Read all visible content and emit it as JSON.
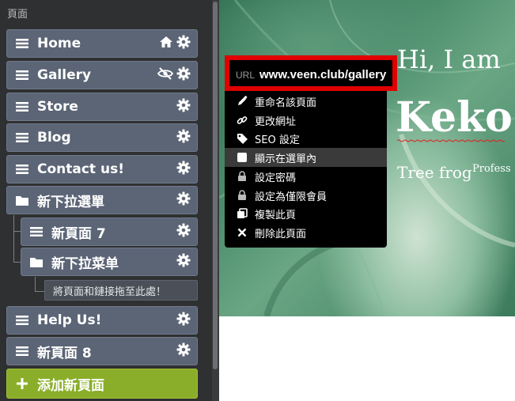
{
  "sidebar": {
    "title": "頁面",
    "pages": [
      {
        "label": "Home",
        "home": true
      },
      {
        "label": "Gallery",
        "hidden": true
      },
      {
        "label": "Store"
      },
      {
        "label": "Blog"
      },
      {
        "label": "Contact us!"
      },
      {
        "label": "新下拉選單"
      },
      {
        "label": "新頁面 7"
      },
      {
        "label": "新下拉菜单"
      },
      {
        "label": "Help Us!"
      },
      {
        "label": "新頁面 8"
      }
    ],
    "drop_hint": "將頁面和鏈接拖至此處！",
    "add_button": "添加新頁面"
  },
  "preview": {
    "greeting": "Hi, I am",
    "name": "Keko",
    "subtitle": "Tree frog",
    "subtitle_sup": "Profess"
  },
  "context_menu": {
    "url_prefix": "URL",
    "url": "www.veen.club/gallery",
    "items": [
      {
        "label": "重命名該頁面",
        "icon": "pencil-icon"
      },
      {
        "label": "更改網址",
        "icon": "link-icon"
      },
      {
        "label": "SEO 設定",
        "icon": "tag-icon"
      },
      {
        "label": "顯示在選單內",
        "icon": "checkbox-icon"
      },
      {
        "label": "設定密碼",
        "icon": "lock-icon"
      },
      {
        "label": "設定為僅限會員",
        "icon": "lock-icon"
      },
      {
        "label": "複製此頁",
        "icon": "copy-icon"
      },
      {
        "label": "刪除此頁面",
        "icon": "close-icon"
      }
    ]
  },
  "colors": {
    "item_bg": "#5c6576",
    "add_bg": "#8aae2a",
    "url_highlight": "#e00000"
  }
}
